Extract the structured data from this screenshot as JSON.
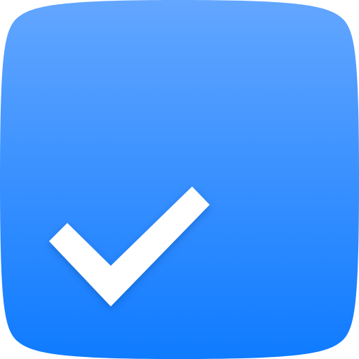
{
  "icon": {
    "name": "checkmark-icon",
    "gradient_top": "#63A6FF",
    "gradient_bottom": "#0F7BFF",
    "check_color": "#FFFFFF"
  }
}
